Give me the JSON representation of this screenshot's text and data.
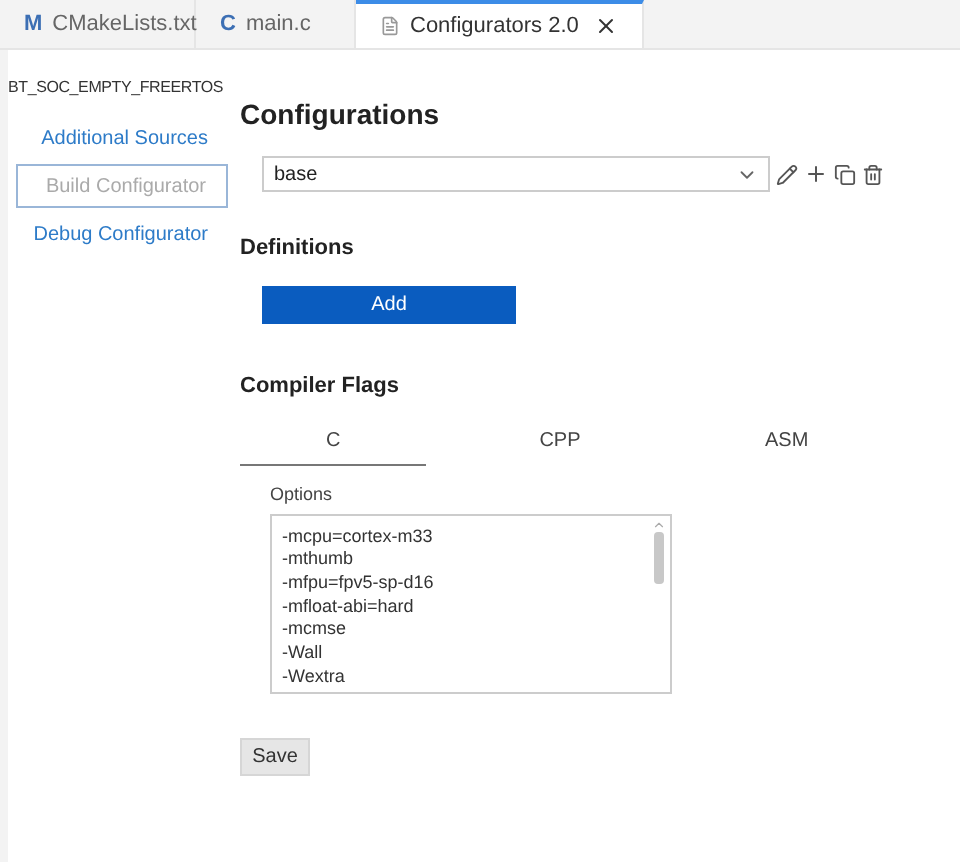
{
  "editor_tabs": [
    {
      "kind": "cmake",
      "glyph": "M",
      "label": "CMakeLists.txt",
      "selected": false
    },
    {
      "kind": "c",
      "glyph": "C",
      "label": "main.c",
      "selected": false
    },
    {
      "kind": "doc",
      "label": "Configurators 2.0",
      "selected": true
    }
  ],
  "project": "BT_SOC_EMPTY_FREERTOS",
  "nav": [
    {
      "label": "Additional Sources",
      "selected": false
    },
    {
      "label": "Build Configurator",
      "selected": true
    },
    {
      "label": "Debug Configurator",
      "selected": false
    }
  ],
  "configurations": {
    "title": "Configurations",
    "value": "base"
  },
  "definitions": {
    "title": "Definitions",
    "add_button": "Add"
  },
  "compiler_flags": {
    "title": "Compiler Flags",
    "tabs": [
      {
        "label": "C",
        "selected": true
      },
      {
        "label": "CPP",
        "selected": false
      },
      {
        "label": "ASM",
        "selected": false
      }
    ],
    "options_label": "Options",
    "options": [
      "-mcpu=cortex-m33",
      "-mthumb",
      "-mfpu=fpv5-sp-d16",
      "-mfloat-abi=hard",
      "-mcmse",
      "-Wall",
      "-Wextra"
    ]
  },
  "save_button": "Save"
}
